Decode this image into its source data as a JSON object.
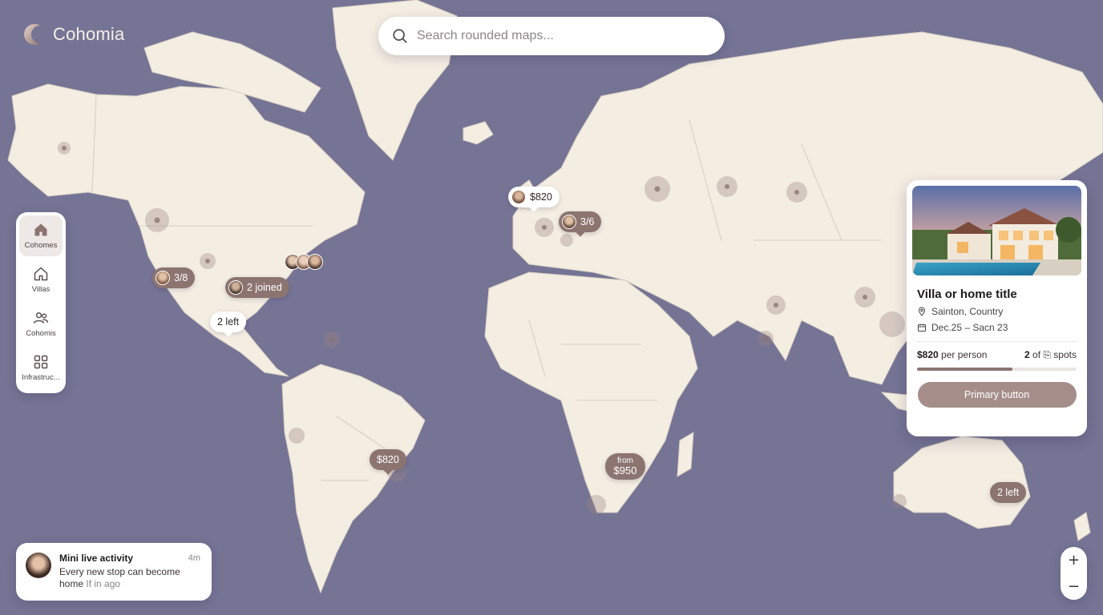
{
  "brand": {
    "name": "Cohomia"
  },
  "search": {
    "placeholder": "Search rounded maps..."
  },
  "sidebar": {
    "items": [
      {
        "label": "Cohomes",
        "icon": "house-filled-icon",
        "active": true
      },
      {
        "label": "Villas",
        "icon": "house-outline-icon",
        "active": false
      },
      {
        "label": "Cohomis",
        "icon": "people-icon",
        "active": false
      },
      {
        "label": "Infrastruc...",
        "icon": "grid-icon",
        "active": false
      }
    ]
  },
  "markers": {
    "europe_price": "$820",
    "europe_spots": "3/6",
    "us_west_spots": "3/8",
    "us_joined": "2 joined",
    "mexico_left": "2 left",
    "brazil_price": "$820",
    "africa_from": "from",
    "africa_price": "$950",
    "australia_left": "2 left"
  },
  "card": {
    "title": "Villa or home title",
    "location": "Sainton, Country",
    "dates": "Dec.25 – Sacn 23",
    "price": "$820",
    "price_suffix": "per person",
    "spots_count": "2",
    "spots_suffix": "of ⎘ spots",
    "spots_filled_fraction": 0.6,
    "button_label": "Primary button"
  },
  "activity": {
    "title": "Mini live activity",
    "time": "4m",
    "message": "Every new stop can become home",
    "ago": "If in ago"
  },
  "zoom": {
    "in_label": "+",
    "out_label": "−"
  },
  "colors": {
    "ocean": "#757495",
    "land": "#f3ede2",
    "accent": "#8c7571",
    "button": "#a58e89"
  }
}
